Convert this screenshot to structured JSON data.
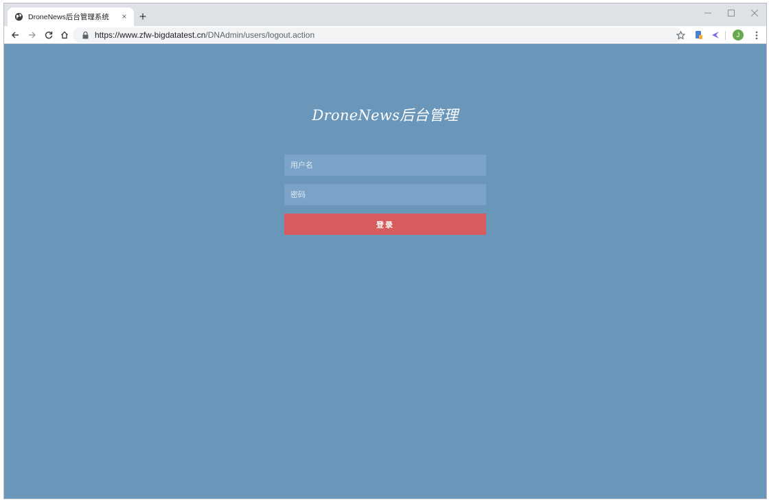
{
  "browser": {
    "tab_title": "DroneNews后台管理系统",
    "tab_close": "×",
    "new_tab": "+",
    "url_host": "https://www.zfw-bigdatatest.cn",
    "url_path": "/DNAdmin/users/logout.action",
    "profile_initial": "J",
    "icons": {
      "favicon": "globe-icon",
      "back": "back-arrow-icon",
      "forward": "forward-arrow-icon",
      "reload": "reload-icon",
      "home": "home-icon",
      "lock": "lock-icon",
      "bookmark": "star-icon",
      "menu": "kebab-menu-icon"
    }
  },
  "login": {
    "title": "DroneNews后台管理",
    "username_placeholder": "用户名",
    "password_placeholder": "密码",
    "submit_label": "登录"
  },
  "colors": {
    "page_bg": "#6a96ba",
    "field_bg": "#7aa3c7",
    "button_bg": "#d75c5e"
  }
}
